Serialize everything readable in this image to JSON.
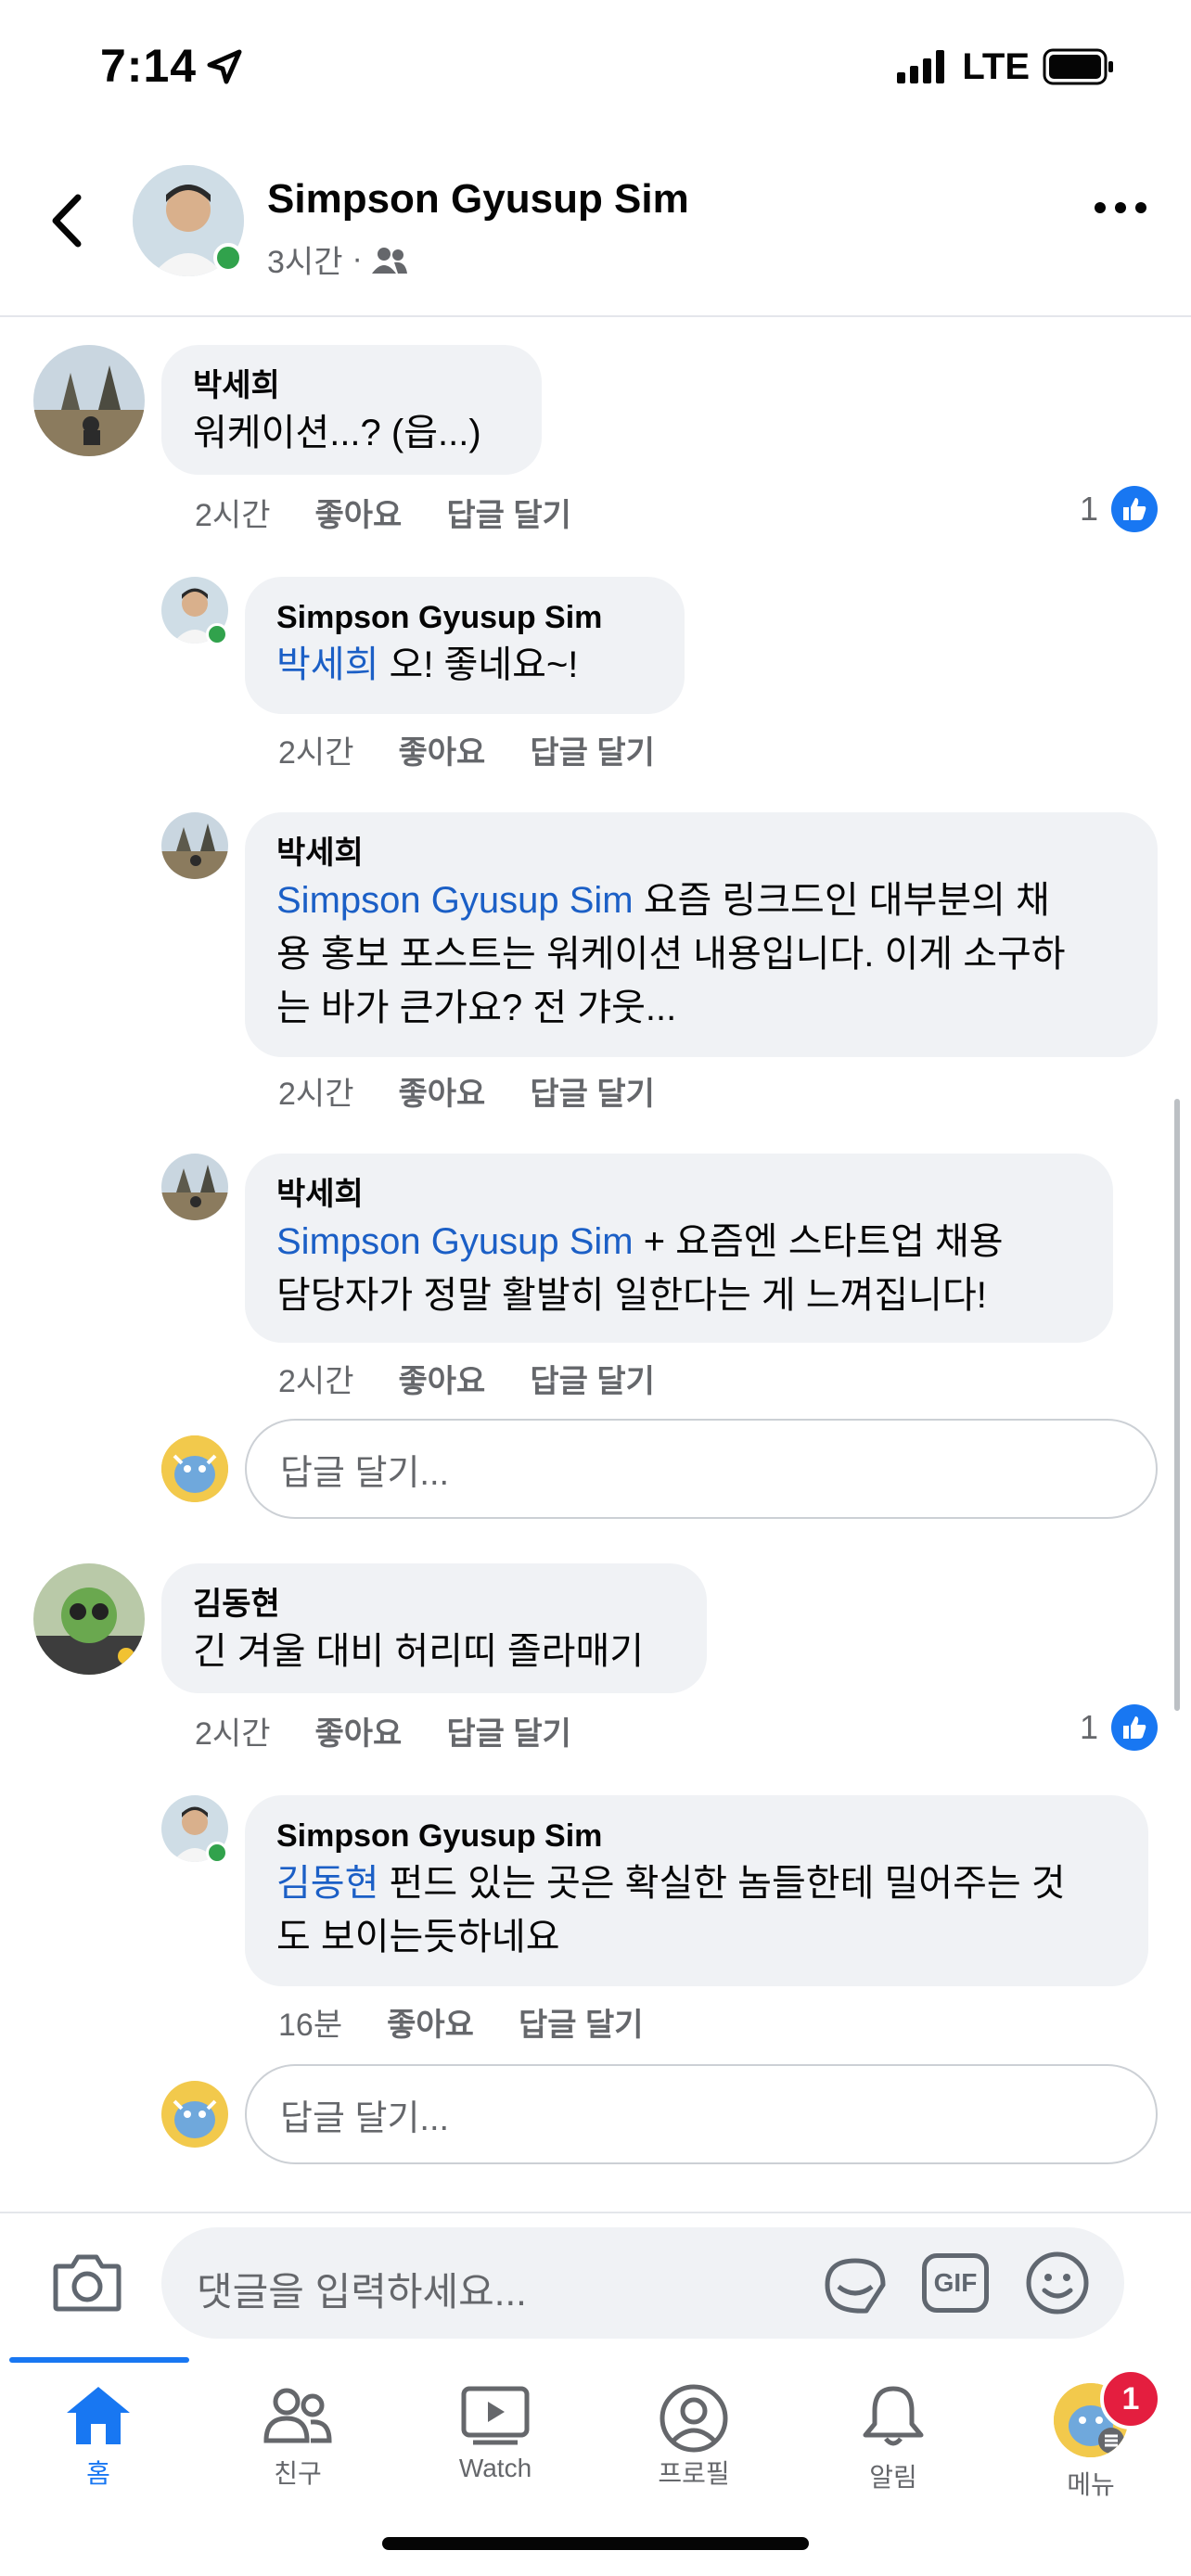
{
  "status": {
    "time": "7:14",
    "network": "LTE"
  },
  "header": {
    "name": "Simpson Gyusup Sim",
    "time": "3시간",
    "separator": "·",
    "audience_icon": "friends-icon"
  },
  "colors": {
    "accent": "#1877f2",
    "mention": "#1b5fc6",
    "bubble": "#f0f2f5",
    "online": "#31a24c",
    "badge": "#e41e3f"
  },
  "comments": [
    {
      "author": "박세희",
      "text": "워케이션...? (읍...)",
      "time": "2시간",
      "like": "좋아요",
      "reply": "답글 달기",
      "likes": "1",
      "replies": [
        {
          "author": "Simpson Gyusup Sim",
          "mention": "박세희",
          "text": " 오! 좋네요~!",
          "time": "2시간",
          "like": "좋아요",
          "reply": "답글 달기"
        },
        {
          "author": "박세희",
          "mention": "Simpson Gyusup Sim",
          "line1": " 요즘 링크드인 대부분의 채",
          "line2": "용 홍보 포스트는 워케이션 내용입니다. 이게 소구하",
          "line3": "는 바가 큰가요? 전 갸웃...",
          "time": "2시간",
          "like": "좋아요",
          "reply": "답글 달기"
        },
        {
          "author": "박세희",
          "mention": "Simpson Gyusup Sim",
          "line1": " + 요즘엔 스타트업 채용",
          "line2": "담당자가 정말 활발히 일한다는 게 느껴집니다!",
          "time": "2시간",
          "like": "좋아요",
          "reply": "답글 달기"
        }
      ],
      "reply_placeholder": "답글 달기..."
    },
    {
      "author": "김동현",
      "text": "긴 겨울 대비 허리띠 졸라매기",
      "time": "2시간",
      "like": "좋아요",
      "reply": "답글 달기",
      "likes": "1",
      "replies": [
        {
          "author": "Simpson Gyusup Sim",
          "mention": "김동현",
          "line1": " 펀드 있는 곳은 확실한 놈들한테 밀어주는 것",
          "line2": "도 보이는듯하네요",
          "time": "16분",
          "like": "좋아요",
          "reply": "답글 달기"
        }
      ],
      "reply_placeholder": "답글 달기..."
    }
  ],
  "composer": {
    "placeholder": "댓글을 입력하세요...",
    "icons": [
      "camera-icon",
      "sticker-icon",
      "gif-icon",
      "emoji-icon"
    ],
    "gif_label": "GIF"
  },
  "tabs": [
    {
      "label": "홈",
      "icon": "home-icon",
      "active": true
    },
    {
      "label": "친구",
      "icon": "friends-icon"
    },
    {
      "label": "Watch",
      "icon": "watch-icon"
    },
    {
      "label": "프로필",
      "icon": "profile-icon"
    },
    {
      "label": "알림",
      "icon": "bell-icon"
    },
    {
      "label": "메뉴",
      "icon": "menu-avatar",
      "badge": "1"
    }
  ]
}
